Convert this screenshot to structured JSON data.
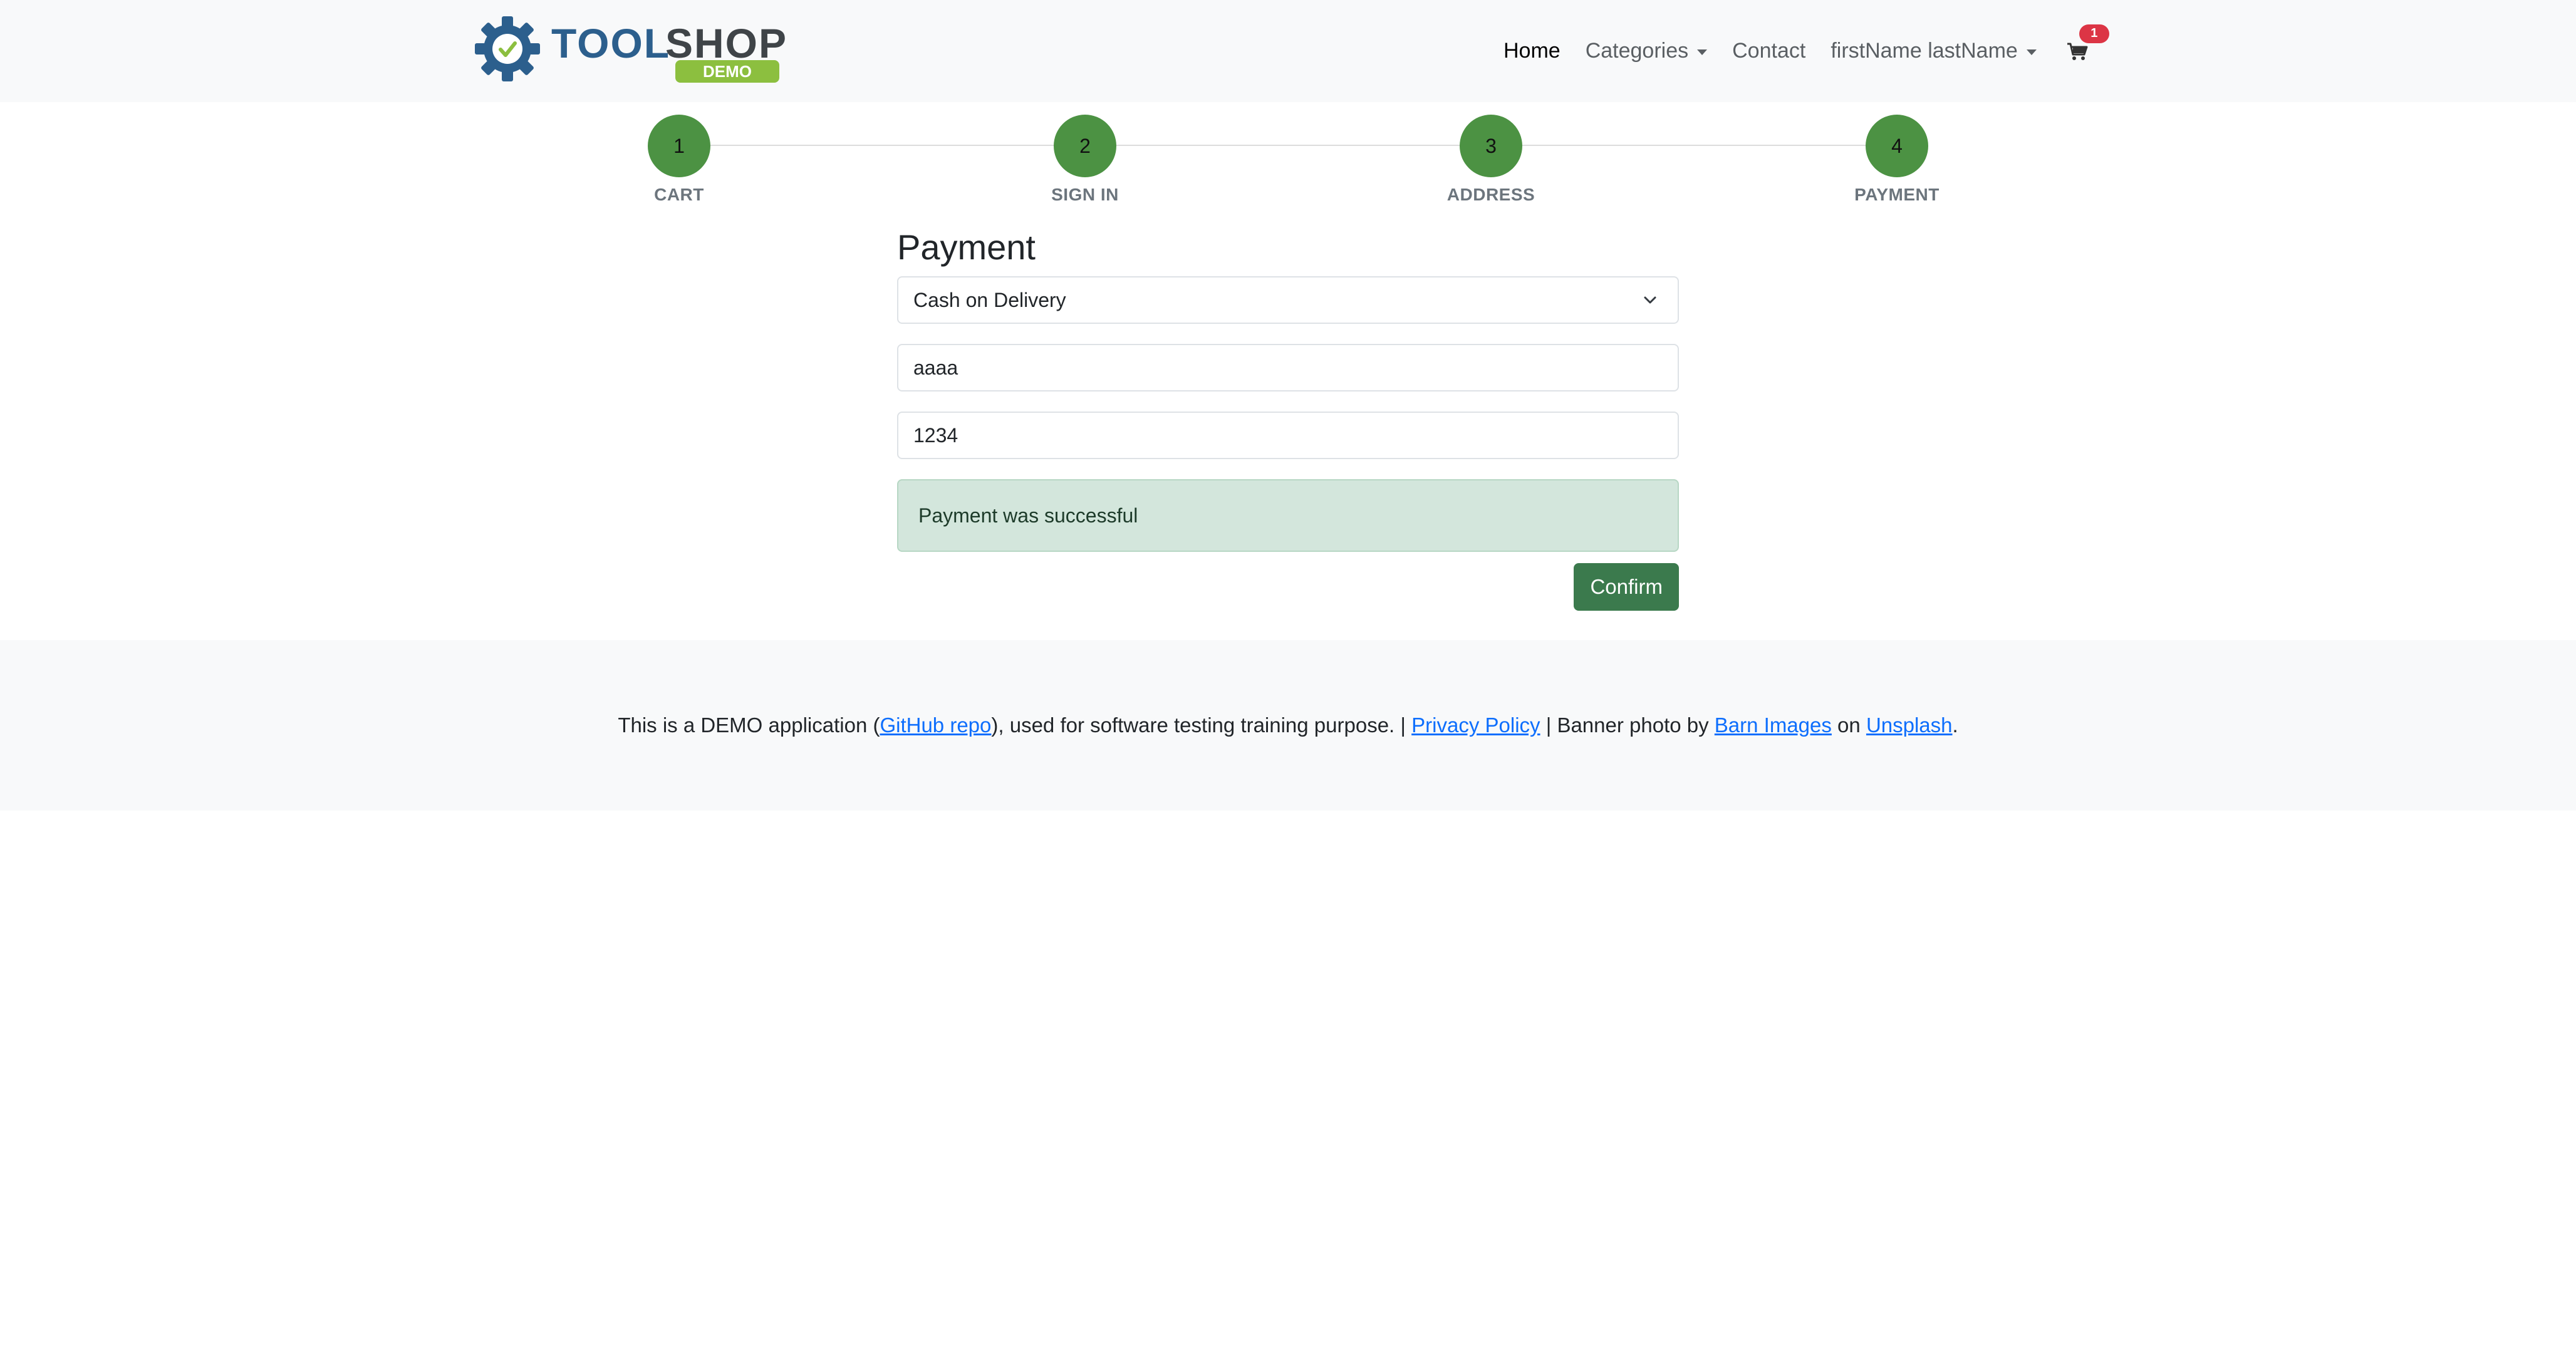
{
  "brand": {
    "logo_text": "TOOLSHOP",
    "logo_badge": "DEMO",
    "colors": {
      "blue": "#2c5f8d",
      "dark": "#3f4448",
      "green": "#8cbf3f"
    }
  },
  "nav": {
    "home": "Home",
    "categories": "Categories",
    "contact": "Contact",
    "user": "firstName lastName",
    "cart_count": "1"
  },
  "stepper": {
    "steps": [
      {
        "number": "1",
        "label": "CART"
      },
      {
        "number": "2",
        "label": "SIGN IN"
      },
      {
        "number": "3",
        "label": "ADDRESS"
      },
      {
        "number": "4",
        "label": "PAYMENT"
      }
    ],
    "color": "#4c9243"
  },
  "payment": {
    "title": "Payment",
    "method_selected": "Cash on Delivery",
    "field1_value": "aaaa",
    "field2_value": "1234",
    "alert_text": "Payment was successful",
    "confirm_label": "Confirm"
  },
  "footer": {
    "text_before": "This is a DEMO application (",
    "github_link": "GitHub repo",
    "text_mid1": "), used for software testing training purpose. | ",
    "privacy_link": "Privacy Policy",
    "text_mid2": " | Banner photo by ",
    "barn_link": "Barn Images",
    "text_mid3": " on ",
    "unsplash_link": "Unsplash",
    "text_end": "."
  }
}
